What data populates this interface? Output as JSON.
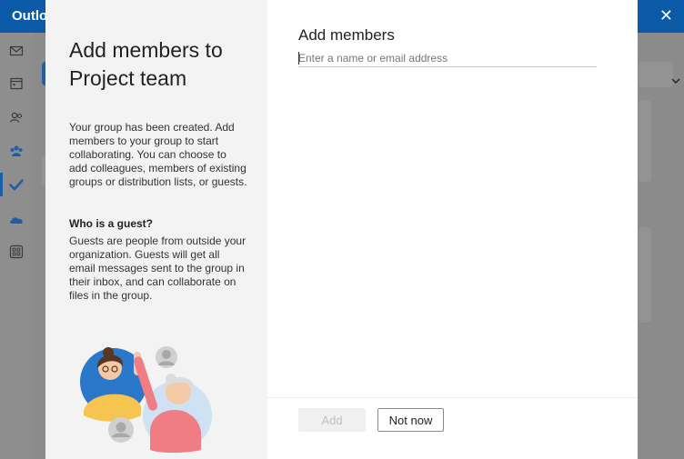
{
  "app": {
    "title": "Outlook"
  },
  "dialog": {
    "title": "Add members to Project team",
    "description": "Your group has been created. Add members to your group to start collaborating. You can choose to add colleagues, members of existing groups or distribution lists, or guests.",
    "guest_heading": "Who is a guest?",
    "guest_description": "Guests are people from outside your organization. Guests will get all email messages sent to the group in their inbox, and can collaborate on files in the group.",
    "add_members_heading": "Add members",
    "input": {
      "placeholder": "Enter a name or email address",
      "value": ""
    },
    "buttons": {
      "add": "Add",
      "not_now": "Not now"
    }
  },
  "rail_icons": [
    "mail-icon",
    "calendar-icon",
    "people-icon",
    "groups-icon",
    "todo-icon",
    "onedrive-icon",
    "apps-icon"
  ],
  "colors": {
    "brand": "#0a5aa8",
    "accent": "#1d5ea8"
  }
}
